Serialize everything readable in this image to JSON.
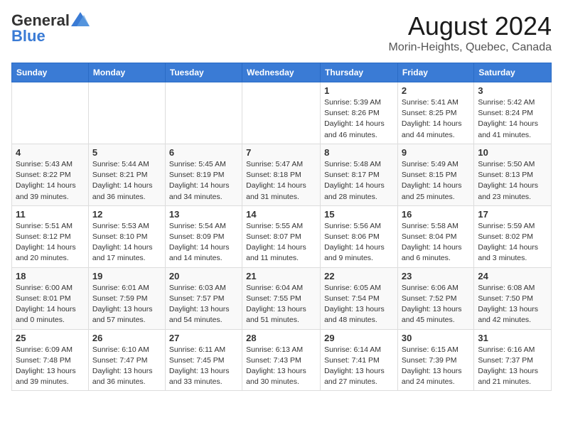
{
  "header": {
    "logo_general": "General",
    "logo_blue": "Blue",
    "month": "August 2024",
    "location": "Morin-Heights, Quebec, Canada"
  },
  "days_of_week": [
    "Sunday",
    "Monday",
    "Tuesday",
    "Wednesday",
    "Thursday",
    "Friday",
    "Saturday"
  ],
  "weeks": [
    [
      {
        "day": "",
        "info": ""
      },
      {
        "day": "",
        "info": ""
      },
      {
        "day": "",
        "info": ""
      },
      {
        "day": "",
        "info": ""
      },
      {
        "day": "1",
        "info": "Sunrise: 5:39 AM\nSunset: 8:26 PM\nDaylight: 14 hours\nand 46 minutes."
      },
      {
        "day": "2",
        "info": "Sunrise: 5:41 AM\nSunset: 8:25 PM\nDaylight: 14 hours\nand 44 minutes."
      },
      {
        "day": "3",
        "info": "Sunrise: 5:42 AM\nSunset: 8:24 PM\nDaylight: 14 hours\nand 41 minutes."
      }
    ],
    [
      {
        "day": "4",
        "info": "Sunrise: 5:43 AM\nSunset: 8:22 PM\nDaylight: 14 hours\nand 39 minutes."
      },
      {
        "day": "5",
        "info": "Sunrise: 5:44 AM\nSunset: 8:21 PM\nDaylight: 14 hours\nand 36 minutes."
      },
      {
        "day": "6",
        "info": "Sunrise: 5:45 AM\nSunset: 8:19 PM\nDaylight: 14 hours\nand 34 minutes."
      },
      {
        "day": "7",
        "info": "Sunrise: 5:47 AM\nSunset: 8:18 PM\nDaylight: 14 hours\nand 31 minutes."
      },
      {
        "day": "8",
        "info": "Sunrise: 5:48 AM\nSunset: 8:17 PM\nDaylight: 14 hours\nand 28 minutes."
      },
      {
        "day": "9",
        "info": "Sunrise: 5:49 AM\nSunset: 8:15 PM\nDaylight: 14 hours\nand 25 minutes."
      },
      {
        "day": "10",
        "info": "Sunrise: 5:50 AM\nSunset: 8:13 PM\nDaylight: 14 hours\nand 23 minutes."
      }
    ],
    [
      {
        "day": "11",
        "info": "Sunrise: 5:51 AM\nSunset: 8:12 PM\nDaylight: 14 hours\nand 20 minutes."
      },
      {
        "day": "12",
        "info": "Sunrise: 5:53 AM\nSunset: 8:10 PM\nDaylight: 14 hours\nand 17 minutes."
      },
      {
        "day": "13",
        "info": "Sunrise: 5:54 AM\nSunset: 8:09 PM\nDaylight: 14 hours\nand 14 minutes."
      },
      {
        "day": "14",
        "info": "Sunrise: 5:55 AM\nSunset: 8:07 PM\nDaylight: 14 hours\nand 11 minutes."
      },
      {
        "day": "15",
        "info": "Sunrise: 5:56 AM\nSunset: 8:06 PM\nDaylight: 14 hours\nand 9 minutes."
      },
      {
        "day": "16",
        "info": "Sunrise: 5:58 AM\nSunset: 8:04 PM\nDaylight: 14 hours\nand 6 minutes."
      },
      {
        "day": "17",
        "info": "Sunrise: 5:59 AM\nSunset: 8:02 PM\nDaylight: 14 hours\nand 3 minutes."
      }
    ],
    [
      {
        "day": "18",
        "info": "Sunrise: 6:00 AM\nSunset: 8:01 PM\nDaylight: 14 hours\nand 0 minutes."
      },
      {
        "day": "19",
        "info": "Sunrise: 6:01 AM\nSunset: 7:59 PM\nDaylight: 13 hours\nand 57 minutes."
      },
      {
        "day": "20",
        "info": "Sunrise: 6:03 AM\nSunset: 7:57 PM\nDaylight: 13 hours\nand 54 minutes."
      },
      {
        "day": "21",
        "info": "Sunrise: 6:04 AM\nSunset: 7:55 PM\nDaylight: 13 hours\nand 51 minutes."
      },
      {
        "day": "22",
        "info": "Sunrise: 6:05 AM\nSunset: 7:54 PM\nDaylight: 13 hours\nand 48 minutes."
      },
      {
        "day": "23",
        "info": "Sunrise: 6:06 AM\nSunset: 7:52 PM\nDaylight: 13 hours\nand 45 minutes."
      },
      {
        "day": "24",
        "info": "Sunrise: 6:08 AM\nSunset: 7:50 PM\nDaylight: 13 hours\nand 42 minutes."
      }
    ],
    [
      {
        "day": "25",
        "info": "Sunrise: 6:09 AM\nSunset: 7:48 PM\nDaylight: 13 hours\nand 39 minutes."
      },
      {
        "day": "26",
        "info": "Sunrise: 6:10 AM\nSunset: 7:47 PM\nDaylight: 13 hours\nand 36 minutes."
      },
      {
        "day": "27",
        "info": "Sunrise: 6:11 AM\nSunset: 7:45 PM\nDaylight: 13 hours\nand 33 minutes."
      },
      {
        "day": "28",
        "info": "Sunrise: 6:13 AM\nSunset: 7:43 PM\nDaylight: 13 hours\nand 30 minutes."
      },
      {
        "day": "29",
        "info": "Sunrise: 6:14 AM\nSunset: 7:41 PM\nDaylight: 13 hours\nand 27 minutes."
      },
      {
        "day": "30",
        "info": "Sunrise: 6:15 AM\nSunset: 7:39 PM\nDaylight: 13 hours\nand 24 minutes."
      },
      {
        "day": "31",
        "info": "Sunrise: 6:16 AM\nSunset: 7:37 PM\nDaylight: 13 hours\nand 21 minutes."
      }
    ]
  ]
}
